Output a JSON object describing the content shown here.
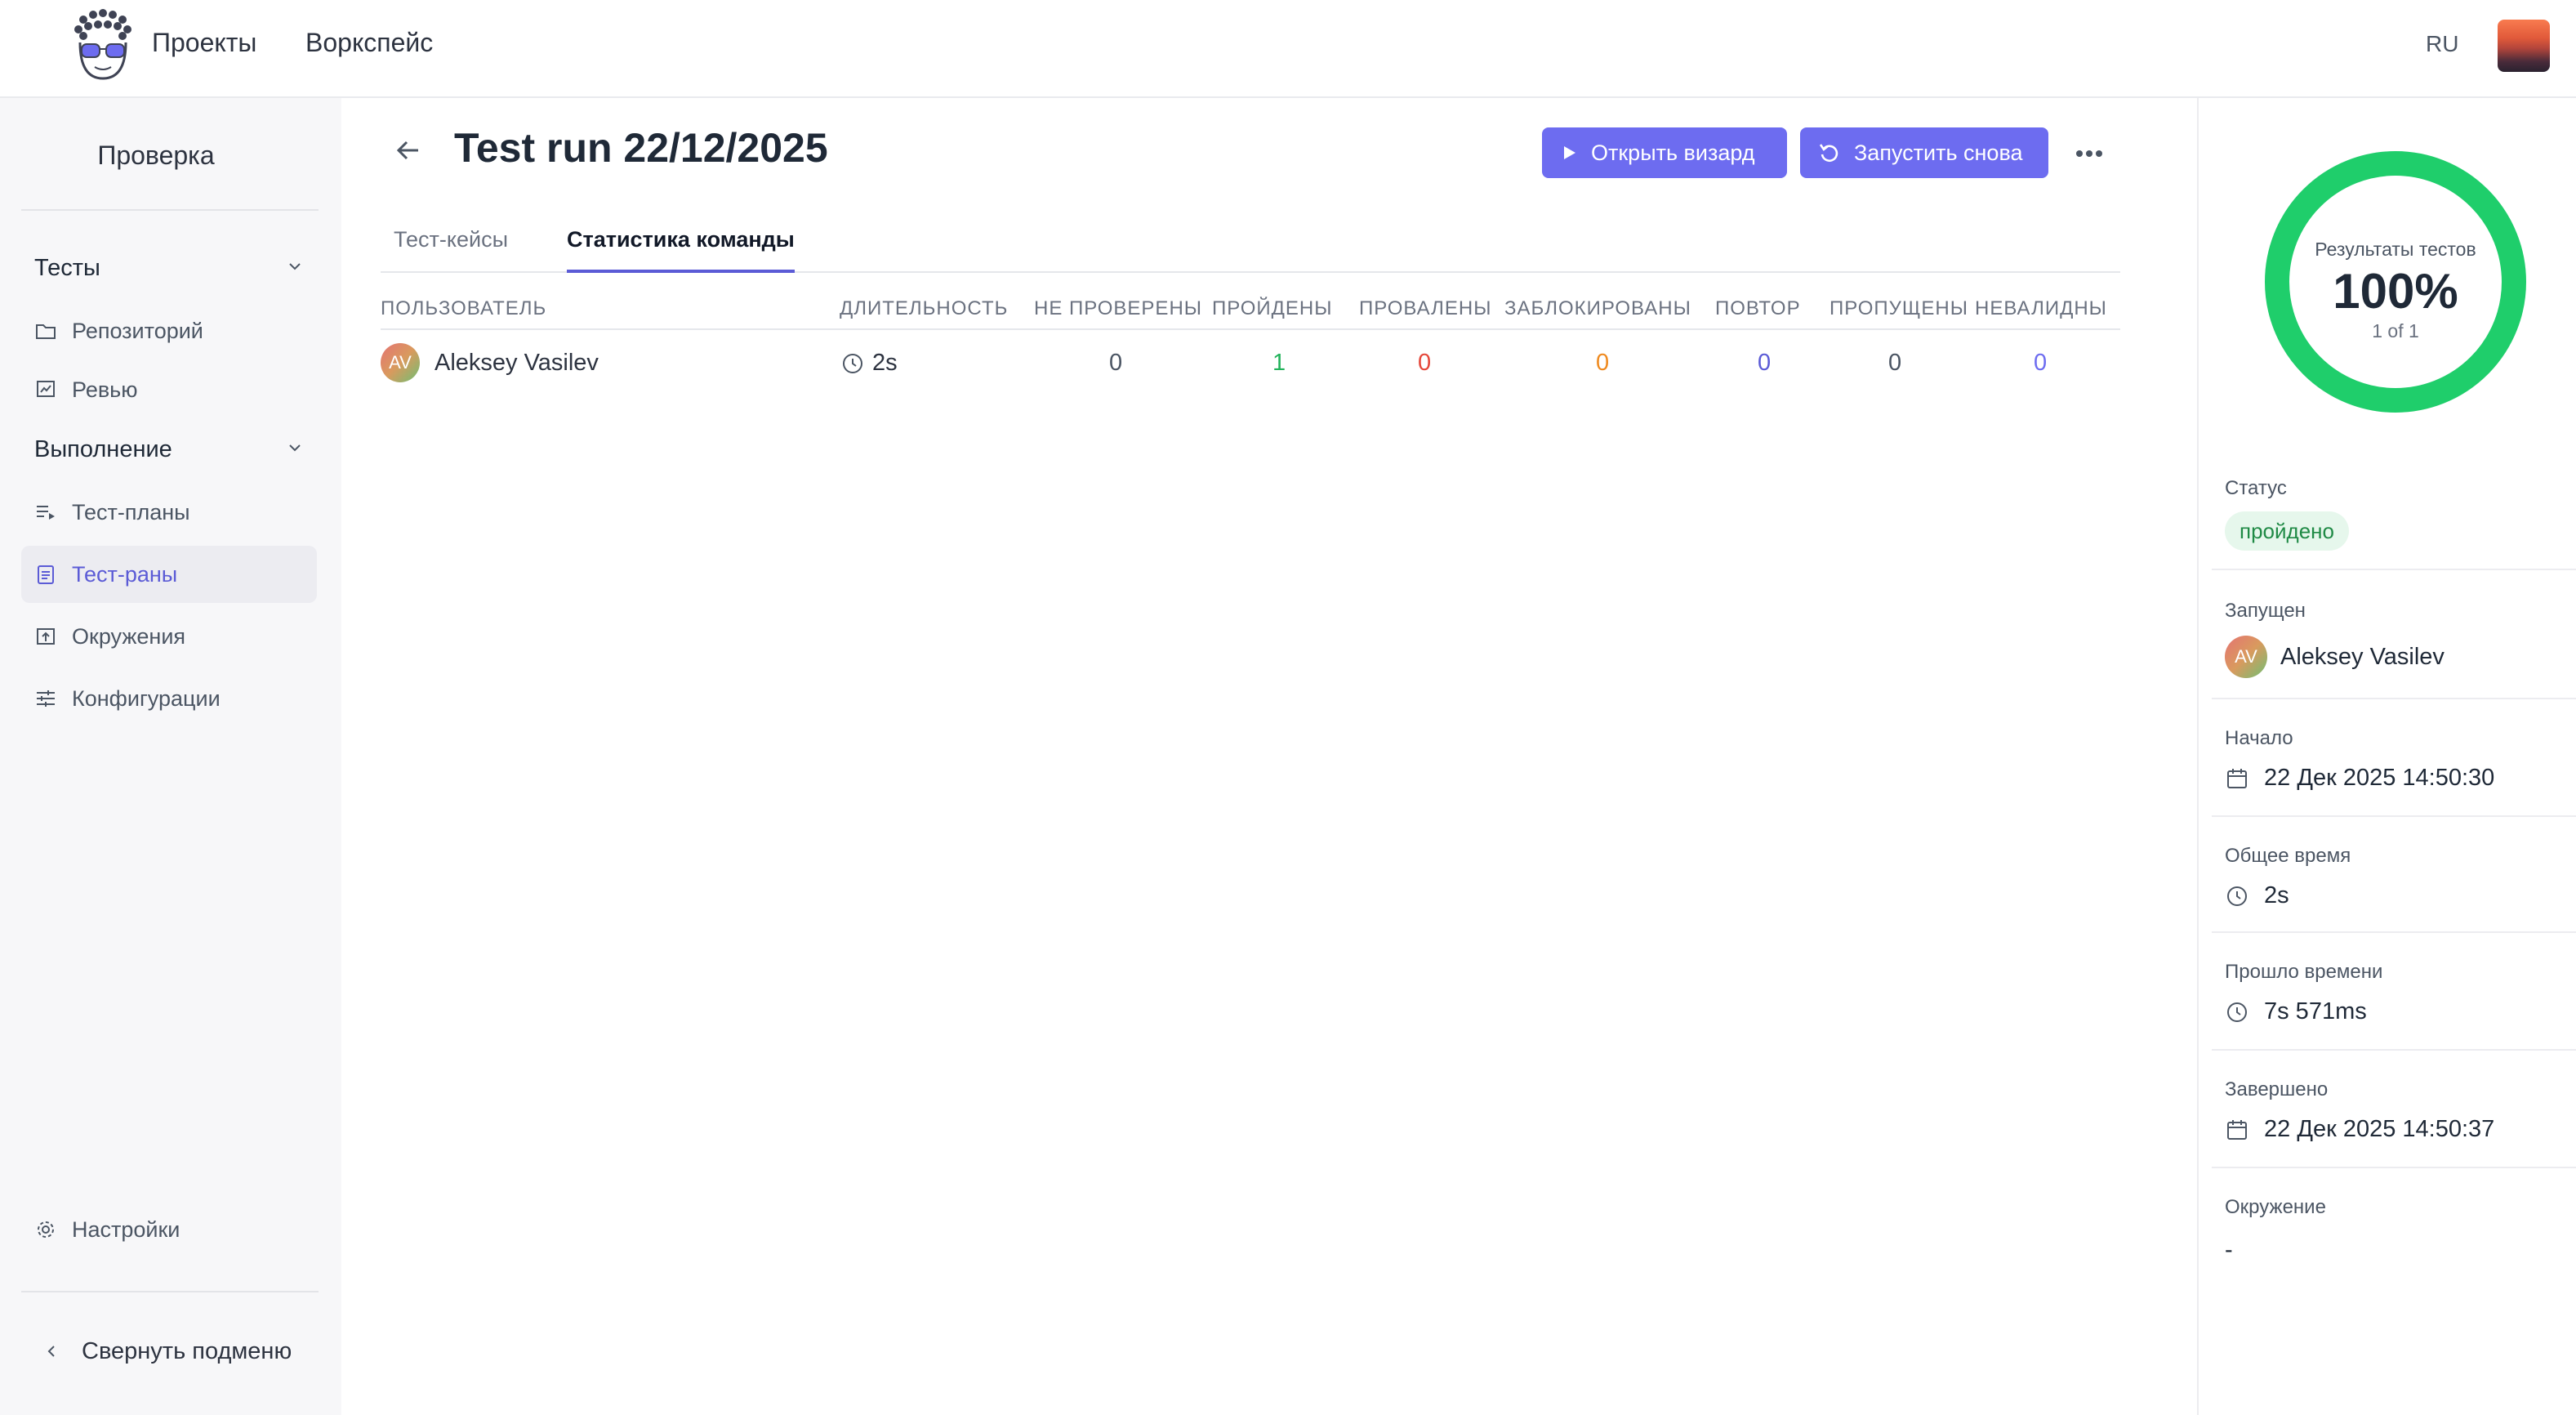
{
  "topbar": {
    "nav": [
      "Проекты",
      "Воркспейс"
    ],
    "language": "RU"
  },
  "sidebar": {
    "title": "Проверка",
    "groups": [
      {
        "label": "Тесты",
        "items": [
          {
            "label": "Репозиторий",
            "icon": "folder-icon"
          },
          {
            "label": "Ревью",
            "icon": "review-icon"
          }
        ]
      },
      {
        "label": "Выполнение",
        "items": [
          {
            "label": "Тест-планы",
            "icon": "playlist-icon"
          },
          {
            "label": "Тест-раны",
            "icon": "clipboard-icon",
            "active": true
          },
          {
            "label": "Окружения",
            "icon": "environment-icon"
          },
          {
            "label": "Конфигурации",
            "icon": "sliders-icon"
          }
        ]
      }
    ],
    "settings_label": "Настройки",
    "collapse_label": "Свернуть подменю"
  },
  "header": {
    "title": "Test run 22/12/2025",
    "open_wizard_label": "Открыть визард",
    "rerun_label": "Запустить снова"
  },
  "tabs": [
    {
      "label": "Тест-кейсы",
      "active": false
    },
    {
      "label": "Статистика команды",
      "active": true
    }
  ],
  "table": {
    "columns": [
      "Пользователь",
      "Длительность",
      "Не проверены",
      "Пройдены",
      "Провалены",
      "Заблокированы",
      "Повтор",
      "Пропущены",
      "Невалидны"
    ],
    "rows": [
      {
        "avatar": "AV",
        "user": "Aleksey Vasilev",
        "duration": "2s",
        "untested": "0",
        "passed": "1",
        "failed": "0",
        "blocked": "0",
        "retest": "0",
        "skipped": "0",
        "invalid": "0"
      }
    ]
  },
  "summary": {
    "donut_title": "Результаты тестов",
    "percent": "100%",
    "percent_value": 100,
    "count": "1 of 1",
    "status_label": "Статус",
    "status_value": "пройдено",
    "started_by_label": "Запущен",
    "started_by_avatar": "AV",
    "started_by": "Aleksey Vasilev",
    "start_label": "Начало",
    "start_value": "22 Дек 2025 14:50:30",
    "total_time_label": "Общее время",
    "total_time_value": "2s",
    "elapsed_label": "Прошло времени",
    "elapsed_value": "7s 571ms",
    "finished_label": "Завершено",
    "finished_value": "22 Дек 2025 14:50:37",
    "environment_label": "Окружение",
    "environment_value": "-"
  },
  "colors": {
    "accent": "#6d6cf0",
    "passed": "#22b35b",
    "failed": "#e5483b",
    "blocked": "#ef8a1f",
    "retest": "#5b5bd6",
    "invalid": "#6d6cf0",
    "donut": "#1fce6b"
  }
}
